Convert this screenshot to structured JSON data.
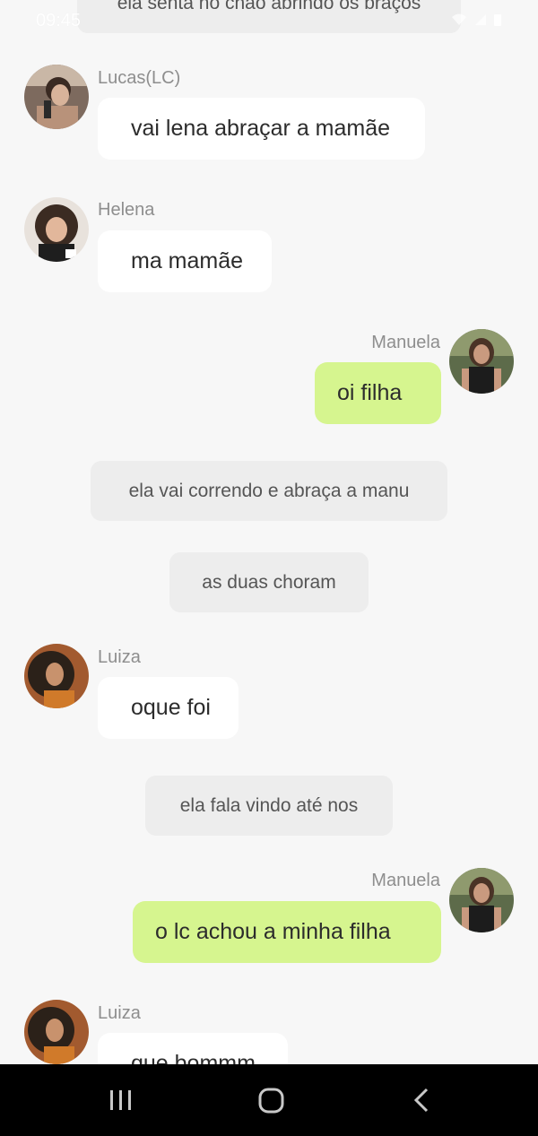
{
  "status_bar": {
    "time": "09:45"
  },
  "messages": [
    {
      "type": "narration",
      "text": "ela senta no chão abrindo os braços"
    },
    {
      "type": "incoming",
      "sender": "Lucas(LC)",
      "text": "vai lena abraçar a mamãe"
    },
    {
      "type": "incoming",
      "sender": "Helena",
      "text": "ma mamãe"
    },
    {
      "type": "outgoing",
      "sender": "Manuela",
      "text": "oi filha"
    },
    {
      "type": "narration",
      "text": "ela vai correndo e abraça a manu"
    },
    {
      "type": "narration",
      "text": "as duas choram"
    },
    {
      "type": "incoming",
      "sender": "Luiza",
      "text": "oque foi"
    },
    {
      "type": "narration",
      "text": "ela fala vindo até nos"
    },
    {
      "type": "outgoing",
      "sender": "Manuela",
      "text": "o lc achou a minha filha"
    },
    {
      "type": "incoming",
      "sender": "Luiza",
      "text": "que bommm"
    }
  ],
  "colors": {
    "background": "#f7f7f7",
    "incoming_bubble": "#ffffff",
    "outgoing_bubble": "#d6f58f",
    "narration_bubble": "#ededed",
    "sender_name": "#8e8e8e",
    "nav_bar": "#000000"
  },
  "nav_bar": {
    "recents_icon": "recents-icon",
    "home_icon": "home-icon",
    "back_icon": "back-icon"
  }
}
